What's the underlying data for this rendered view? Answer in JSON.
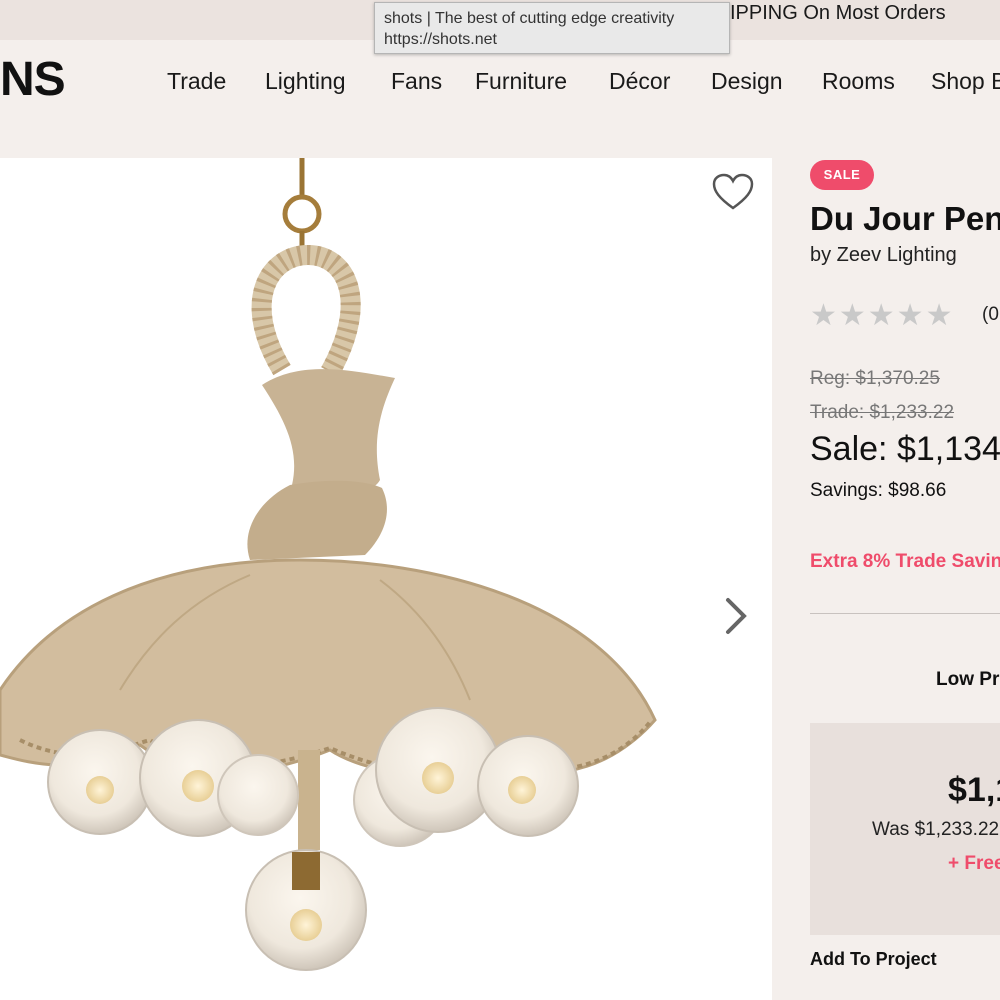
{
  "tooltip": {
    "title": "shots | The best of cutting edge creativity",
    "url": "https://shots.net"
  },
  "promo": {
    "text": "IPPING On Most Orders"
  },
  "header": {
    "logo": "NS"
  },
  "nav": {
    "items": [
      "Trade",
      "Lighting",
      "Fans",
      "Furniture",
      "Décor",
      "Design",
      "Rooms",
      "Shop B"
    ]
  },
  "product": {
    "badge": "SALE",
    "title": "Du Jour Pen",
    "brand": "by Zeev Lighting",
    "rating": {
      "stars": "★★★★★",
      "count": "(0",
      "value": 0,
      "max": 5
    },
    "reg_price": "Reg: $1,370.25",
    "trade_price": "Trade: $1,233.22",
    "sale_price": "Sale: $1,134.",
    "savings": "Savings: $98.66",
    "extra_savings": "Extra 8% Trade Savin",
    "low_price_label": "Low Pri",
    "box": {
      "price": "$1,1",
      "was": "Was $1,233.22",
      "free": "+ Free"
    },
    "add_to_project": "Add To Project"
  },
  "icons": {
    "favorite": "heart-icon",
    "next": "chevron-right-icon",
    "rating": "star-icon"
  },
  "colors": {
    "accent": "#ef4c6b",
    "background": "#f4efec",
    "topbar": "#ebe3df",
    "pricebox": "#e8e0dc"
  }
}
